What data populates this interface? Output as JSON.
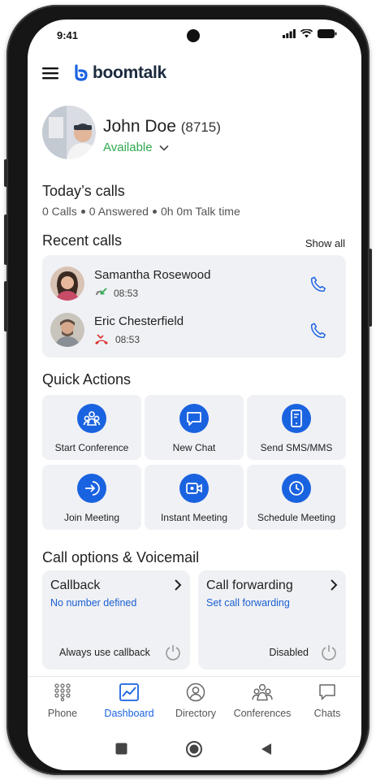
{
  "status_bar": {
    "time": "9:41"
  },
  "app": {
    "brand_name": "boomtalk"
  },
  "profile": {
    "name": "John Doe",
    "extension": "(8715)",
    "presence": "Available"
  },
  "todays_calls": {
    "title": "Today’s calls",
    "calls": "0 Calls",
    "answered": "0 Answered",
    "talk_time": "0h 0m Talk time"
  },
  "recent_calls": {
    "title": "Recent calls",
    "show_all": "Show all",
    "items": [
      {
        "name": "Samantha Rosewood",
        "time": "08:53",
        "direction": "incoming"
      },
      {
        "name": "Eric Chesterfield",
        "time": "08:53",
        "direction": "missed"
      }
    ]
  },
  "quick_actions": {
    "title": "Quick Actions",
    "items": [
      {
        "label": "Start Conference",
        "icon": "conference-icon"
      },
      {
        "label": "New Chat",
        "icon": "chat-icon"
      },
      {
        "label": "Send SMS/MMS",
        "icon": "sms-icon"
      },
      {
        "label": "Join Meeting",
        "icon": "join-meeting-icon"
      },
      {
        "label": "Instant Meeting",
        "icon": "video-icon"
      },
      {
        "label": "Schedule Meeting",
        "icon": "clock-icon"
      }
    ]
  },
  "call_options": {
    "title": "Call options & Voicemail",
    "callback": {
      "title": "Callback",
      "link": "No number defined",
      "footer": "Always use callback"
    },
    "forwarding": {
      "title": "Call forwarding",
      "link": "Set call forwarding",
      "footer": "Disabled"
    }
  },
  "bottom_nav": [
    {
      "label": "Phone",
      "icon": "dialpad-icon"
    },
    {
      "label": "Dashboard",
      "icon": "chart-icon",
      "active": true
    },
    {
      "label": "Directory",
      "icon": "user-icon"
    },
    {
      "label": "Conferences",
      "icon": "group-icon"
    },
    {
      "label": "Chats",
      "icon": "chat-icon"
    }
  ],
  "colors": {
    "accent": "#1a63e0",
    "available": "#2fa84f",
    "missed": "#d9302c",
    "card": "#f0f1f5"
  }
}
